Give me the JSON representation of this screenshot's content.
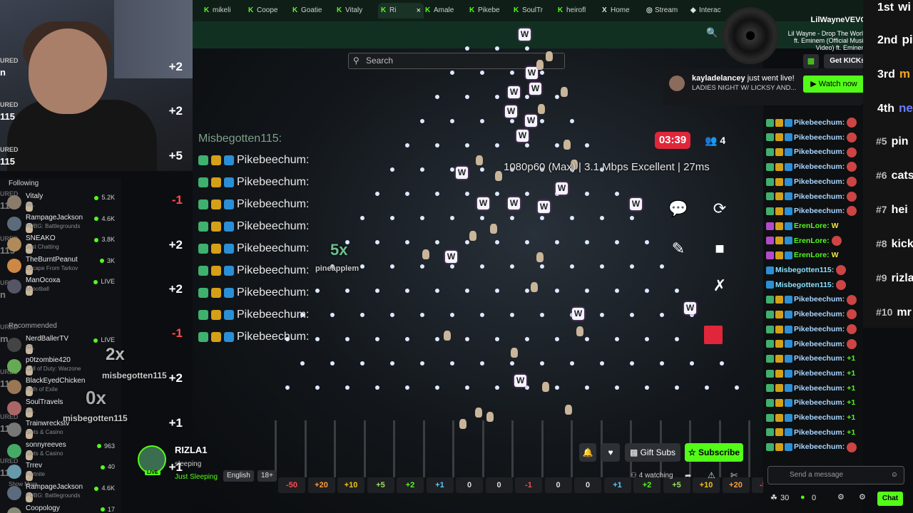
{
  "tabs": [
    {
      "label": "mikeli",
      "icon": "K"
    },
    {
      "label": "Coope",
      "icon": "K"
    },
    {
      "label": "Goatie",
      "icon": "K"
    },
    {
      "label": "Vitaly",
      "icon": "K"
    },
    {
      "label": "Ri",
      "icon": "K",
      "active": true
    },
    {
      "label": "Amale",
      "icon": "K"
    },
    {
      "label": "Pikebe",
      "icon": "K"
    },
    {
      "label": "SoulTr",
      "icon": "K"
    },
    {
      "label": "heirofl",
      "icon": "K"
    },
    {
      "label": "Home",
      "icon": "X"
    },
    {
      "label": "Stream",
      "icon": "◎"
    },
    {
      "label": "Interac",
      "icon": "◆"
    }
  ],
  "search": {
    "placeholder": "Search"
  },
  "ranking_left": [
    {
      "tag": "URED",
      "name": "n",
      "delta": "+2"
    },
    {
      "tag": "URED",
      "name": "115",
      "delta": "+2"
    },
    {
      "tag": "URED",
      "name": "115",
      "delta": "+5"
    },
    {
      "tag": "URED",
      "name": "115",
      "delta": "-1"
    },
    {
      "tag": "URED",
      "name": "115",
      "delta": "+2"
    },
    {
      "tag": "URED",
      "name": "n",
      "delta": "+2"
    },
    {
      "tag": "URED",
      "name": "m",
      "delta": "-1"
    },
    {
      "tag": "URED",
      "name": "115",
      "delta": "+2"
    },
    {
      "tag": "URED",
      "name": "115",
      "delta": "+1"
    },
    {
      "tag": "URED",
      "name": "115",
      "delta": "+1"
    }
  ],
  "sidebar": {
    "following_label": "Following",
    "following": [
      {
        "name": "Vitaly",
        "category": "IRL",
        "viewers": "5.2K"
      },
      {
        "name": "RampageJackson",
        "category": "PUBG: Battlegrounds",
        "viewers": "4.6K"
      },
      {
        "name": "SNEAKO",
        "category": "Just Chatting",
        "viewers": "3.8K"
      },
      {
        "name": "TheBurntPeanut",
        "category": "Escape From Tarkov",
        "viewers": "3K"
      },
      {
        "name": "ManOcoxa",
        "category": "eFootball",
        "viewers": "LIVE"
      }
    ],
    "show_more": "Show More",
    "recommended_label": "Recommended",
    "recommended": [
      {
        "name": "NerdBallerTV",
        "category": "IRL",
        "viewers": "LIVE"
      },
      {
        "name": "p0tzombie420",
        "category": "Call of Duty: Warzone",
        "viewers": ""
      },
      {
        "name": "BlackEyedChicken",
        "category": "Path of Exile",
        "viewers": ""
      },
      {
        "name": "SoulTravels",
        "category": "IRL",
        "viewers": ""
      },
      {
        "name": "Trainwreckstv",
        "category": "Slots & Casino",
        "viewers": ""
      },
      {
        "name": "sonnyreeves",
        "category": "Slots & Casino",
        "viewers": "963"
      },
      {
        "name": "Trrev",
        "category": "Fortnite",
        "viewers": "40"
      },
      {
        "name": "RampageJackson",
        "category": "PUBG: Battlegrounds",
        "viewers": "4.6K"
      },
      {
        "name": "Coopology",
        "category": "",
        "viewers": "17"
      }
    ]
  },
  "overlay": {
    "mult_2x": "2x",
    "mult_0x": "0x",
    "mult_5x": "5x",
    "user1": "misbegotten115",
    "user2": "misbegotten115",
    "user3": "pineapplem"
  },
  "stream": {
    "timer": "03:39",
    "viewer_count": "4",
    "stats": "1080p60 (Max) | 3.1 Mbps Excellent | 27ms",
    "chat_header": "Misbegotten115:",
    "chat_lines": [
      "Pikebeechum:",
      "Pikebeechum:",
      "Pikebeechum:",
      "Pikebeechum:",
      "Pikebeechum:",
      "Pikebeechum:",
      "Pikebeechum:",
      "Pikebeechum:",
      "Pikebeechum:"
    ]
  },
  "bins": [
    {
      "label": "-50",
      "color": "#ff4d4d"
    },
    {
      "label": "+20",
      "color": "#ff9d3d"
    },
    {
      "label": "+10",
      "color": "#f0c419"
    },
    {
      "label": "+5",
      "color": "#9be15d"
    },
    {
      "label": "+2",
      "color": "#53fc18"
    },
    {
      "label": "+1",
      "color": "#5ec8ff"
    },
    {
      "label": "0",
      "color": "#dddddd"
    },
    {
      "label": "0",
      "color": "#dddddd"
    },
    {
      "label": "-1",
      "color": "#ff4d4d"
    },
    {
      "label": "0",
      "color": "#dddddd"
    },
    {
      "label": "0",
      "color": "#dddddd"
    },
    {
      "label": "+1",
      "color": "#5ec8ff"
    },
    {
      "label": "+2",
      "color": "#53fc18"
    },
    {
      "label": "+5",
      "color": "#9be15d"
    },
    {
      "label": "+10",
      "color": "#f0c419"
    },
    {
      "label": "+20",
      "color": "#ff9d3d"
    },
    {
      "label": "-50",
      "color": "#ff4d4d"
    }
  ],
  "streamer": {
    "name": "RIZLA1",
    "title": "sleeping",
    "category": "Just Sleeping",
    "live_badge": "LIVE",
    "language": "English",
    "age": "18+"
  },
  "actions": {
    "gift_subs": "Gift Subs",
    "subscribe": "Subscribe",
    "watching": "4 watching"
  },
  "now_playing": {
    "channel": "LilWayneVEVO",
    "song": "Lil Wayne - Drop The World ft. Eminem (Official Music Video) ft. Eminem"
  },
  "get_kicks": "Get KICKs",
  "toast": {
    "user": "kayladelancey",
    "text": "just went live!",
    "title": "LADIES NIGHT W/ LICKSY AND...",
    "button": "Watch now"
  },
  "leaderboard": [
    {
      "rank": "1st",
      "name": "wi"
    },
    {
      "rank": "2nd",
      "name": "pi"
    },
    {
      "rank": "3rd",
      "name": "m"
    },
    {
      "rank": "4th",
      "name": "ne"
    },
    {
      "rank": "#5",
      "name": "pin"
    },
    {
      "rank": "#6",
      "name": "cats"
    },
    {
      "rank": "#7",
      "name": "hei"
    },
    {
      "rank": "#8",
      "name": "kick"
    },
    {
      "rank": "#9",
      "name": "rizla"
    },
    {
      "rank": "#10",
      "name": "mr"
    }
  ],
  "chat": {
    "lines": [
      {
        "name": "Pikebeechum:",
        "msg": "",
        "style": "n"
      },
      {
        "name": "Pikebeechum:",
        "msg": "",
        "style": "n"
      },
      {
        "name": "Pikebeechum:",
        "msg": "",
        "style": "n"
      },
      {
        "name": "Pikebeechum:",
        "msg": "",
        "style": "n"
      },
      {
        "name": "Pikebeechum:",
        "msg": "",
        "style": "n"
      },
      {
        "name": "Pikebeechum:",
        "msg": "",
        "style": "n"
      },
      {
        "name": "Pikebeechum:",
        "msg": "",
        "style": "n"
      },
      {
        "name": "ErenLore:",
        "msg": "W",
        "style": "g"
      },
      {
        "name": "ErenLore:",
        "msg": "",
        "style": "g"
      },
      {
        "name": "ErenLore:",
        "msg": "W",
        "style": "g"
      },
      {
        "name": "Misbegotten115:",
        "msg": "",
        "style": "c"
      },
      {
        "name": "Misbegotten115:",
        "msg": "",
        "style": "c"
      },
      {
        "name": "Pikebeechum:",
        "msg": "",
        "style": "n"
      },
      {
        "name": "Pikebeechum:",
        "msg": "",
        "style": "n"
      },
      {
        "name": "Pikebeechum:",
        "msg": "",
        "style": "n"
      },
      {
        "name": "Pikebeechum:",
        "msg": "",
        "style": "n"
      },
      {
        "name": "Pikebeechum:",
        "msg": "+1",
        "style": "n"
      },
      {
        "name": "Pikebeechum:",
        "msg": "+1",
        "style": "n"
      },
      {
        "name": "Pikebeechum:",
        "msg": "+1",
        "style": "n"
      },
      {
        "name": "Pikebeechum:",
        "msg": "+1",
        "style": "n"
      },
      {
        "name": "Pikebeechum:",
        "msg": "+1",
        "style": "n"
      },
      {
        "name": "Pikebeechum:",
        "msg": "+1",
        "style": "n"
      },
      {
        "name": "Pikebeechum:",
        "msg": "",
        "style": "n"
      }
    ],
    "input_placeholder": "Send a message",
    "points": "30",
    "kicks": "0",
    "chat_button": "Chat"
  }
}
